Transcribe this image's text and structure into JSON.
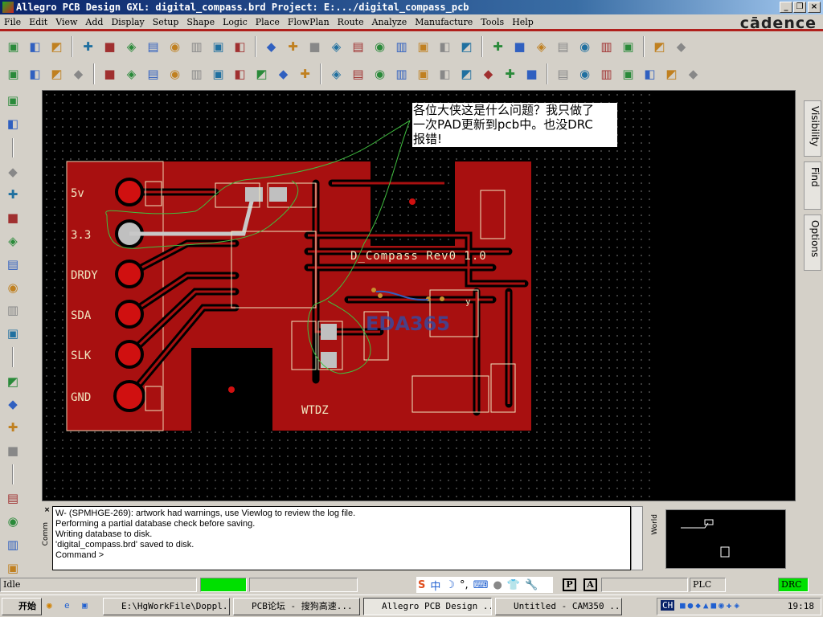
{
  "window": {
    "title": "Allegro PCB Design GXL: digital_compass.brd  Project: E:.../digital_compass_pcb"
  },
  "menu": [
    "File",
    "Edit",
    "View",
    "Add",
    "Display",
    "Setup",
    "Shape",
    "Logic",
    "Place",
    "FlowPlan",
    "Route",
    "Analyze",
    "Manufacture",
    "Tools",
    "Help"
  ],
  "brand": "cādence",
  "toolbar1": [
    "new-icon",
    "open-icon",
    "save-icon",
    "sep",
    "move-icon",
    "copy-icon",
    "delete-icon",
    "undo-icon",
    "redo-icon",
    "undo-step-icon",
    "pick-icon",
    "pin-icon",
    "sep",
    "grid-icon",
    "zoom-fit-icon",
    "zoom-in-icon",
    "zoom-out-icon",
    "zoom-world-icon",
    "zoom-prev-icon",
    "redraw-icon",
    "refresh-icon",
    "3d-icon",
    "flip-icon",
    "sep",
    "grid-toggle-icon",
    "color-icon",
    "layers-icon",
    "shadow-icon",
    "setup-icon",
    "spreadsheet-icon",
    "cm-icon",
    "sep",
    "info-icon",
    "help-icon"
  ],
  "toolbar2": [
    "shape-icon",
    "shape-edit-icon",
    "shape-void-icon",
    "shape-merge-icon",
    "sep",
    "line-icon",
    "rectangle-icon",
    "circle-icon",
    "select-icon",
    "frame-icon",
    "arc-icon",
    "square-icon",
    "round-icon",
    "drill-icon",
    "stamp-icon",
    "sep",
    "package-icon",
    "dimension-icon",
    "measure-icon",
    "clearance-icon",
    "angle-icon",
    "diagonal-icon",
    "no-icon",
    "cut-icon",
    "search-icon",
    "check-icon",
    "sep",
    "report-icon",
    "library-icon",
    "wrench-icon",
    "camera-icon",
    "rename-icon",
    "flag-icon",
    "snap-icon"
  ],
  "left_toolbar": [
    "place-icon",
    "unplaced-icon",
    "sep",
    "route-icon",
    "slide-icon",
    "fanout-icon",
    "tune-icon",
    "autoroute-icon",
    "spread-icon",
    "list-icon",
    "bga-icon",
    "sep",
    "add-line-icon",
    "add-rect-icon",
    "add-text-icon",
    "edit-text-icon",
    "sep",
    "connect-icon",
    "slide-trace-icon",
    "delete-trace-icon",
    "custom-trace-icon"
  ],
  "annotation": {
    "line1": "各位大侠这是什么问题？我只做了",
    "line2": "一次PAD更新到pcb中。也没DRC",
    "line3": "报错!"
  },
  "pcb": {
    "pins": [
      "5v",
      "3.3",
      "DRDY",
      "SDA",
      "SLK",
      "GND"
    ],
    "board_label": "D_Compass Rev0 1.0",
    "bottom_label": "WTDZ",
    "watermark": "EDA365",
    "axis_label": "y",
    "colors": {
      "copper": "#a81010",
      "background": "#000000",
      "ratsnest": "#40c040",
      "outline": "#f0e6c0"
    }
  },
  "right_tabs": [
    "Visibility",
    "Find",
    "Options"
  ],
  "console": {
    "tab_label": "Comm",
    "lines": [
      "W- (SPMHGE-269): artwork had warnings, use Viewlog to review the log file.",
      "Performing a partial database check before saving.",
      "Writing database to disk.",
      "'digital_compass.brd' saved to disk.",
      "Command >"
    ]
  },
  "world": {
    "tab_label": "World"
  },
  "status": {
    "state": "Idle",
    "mode_p": "P",
    "mode_a": "A",
    "plc": "PLC",
    "drc": "DRC",
    "active_color": "#00e000"
  },
  "taskbar": {
    "start": "开始",
    "tasks": [
      "E:\\HgWorkFile\\Doppl...",
      "PCB论坛 - 搜狗高速...",
      "Allegro PCB Design ...",
      "Untitled - CAM350 ..."
    ],
    "lang": "CH",
    "clock": "19:18"
  }
}
